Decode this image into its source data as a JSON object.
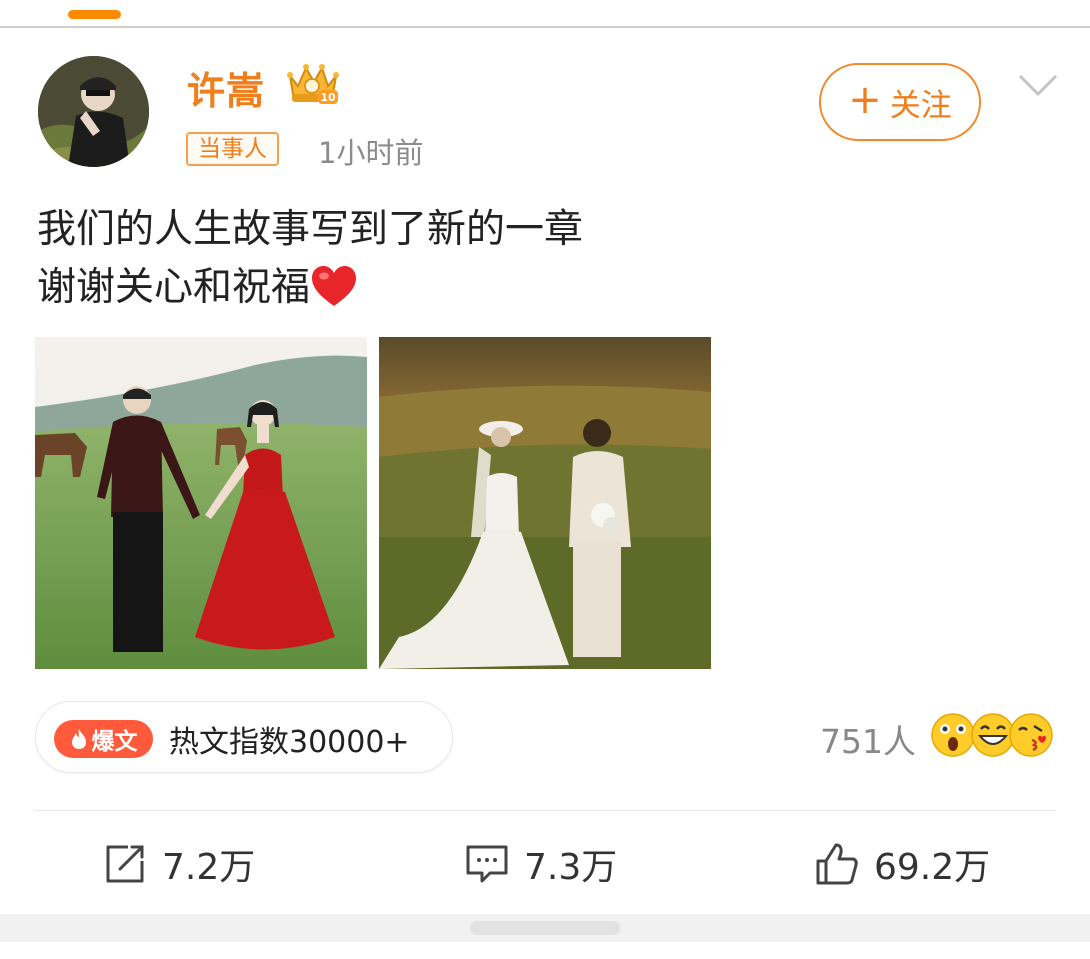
{
  "post": {
    "author": "许嵩",
    "tag": "当事人",
    "time": "1小时前",
    "follow_label": "关注",
    "follow_plus": "+",
    "content_line1": "我们的人生故事写到了新的一章",
    "content_line2": "谢谢关心和祝福",
    "content_emoji": "heart-emoji"
  },
  "hot": {
    "badge_label": "爆文",
    "index_text": "热文指数30000+"
  },
  "reactions": {
    "count": "751人",
    "emojis": [
      "surprised-emoji",
      "grinning-emoji",
      "kiss-emoji"
    ]
  },
  "actions": {
    "repost": "7.2万",
    "comment": "7.3万",
    "like": "69.2万"
  },
  "colors": {
    "accent": "#f07e1b",
    "hot_badge": "#ff5a3c"
  }
}
